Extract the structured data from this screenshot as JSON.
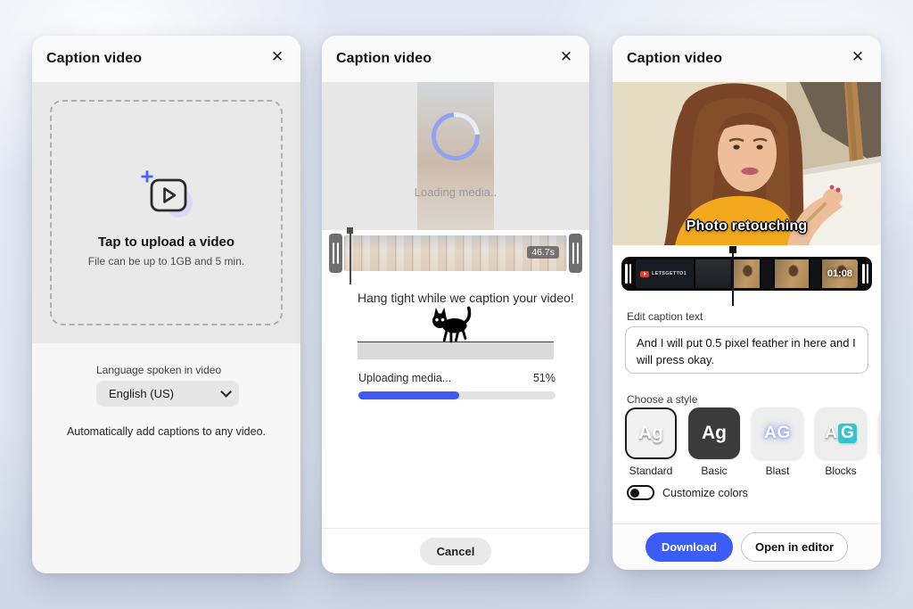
{
  "icons": {
    "close": "✕"
  },
  "colors": {
    "accent": "#3b5cf6",
    "progress": "#3d5af5",
    "teal": "#35c3ce"
  },
  "panel_upload": {
    "title": "Caption video",
    "headline": "Tap to upload a video",
    "subtext": "File can be up to 1GB and 5 min.",
    "language_label": "Language spoken in video",
    "language_value": "English (US)",
    "footnote": "Automatically add captions to any video."
  },
  "panel_progress": {
    "title": "Caption video",
    "loading_text": "Loading media..",
    "duration_badge": "46.7s",
    "headline": "Hang tight while we caption your video!",
    "status_label": "Uploading media...",
    "percent_label": "51%",
    "percent_value": 51,
    "cancel_label": "Cancel"
  },
  "panel_edit": {
    "title": "Caption video",
    "video_caption": "Photo retouching",
    "watermark": "LETSGETTO1",
    "duration_badge": "01:08",
    "edit_label": "Edit caption text",
    "caption_text": "And I will put 0.5 pixel feather in here and I will press okay.",
    "style_label": "Choose a style",
    "styles": [
      {
        "glyph": "Ag",
        "label": "Standard"
      },
      {
        "glyph": "Ag",
        "label": "Basic"
      },
      {
        "glyph": "AG",
        "label": "Blast"
      },
      {
        "glyph_a": "A",
        "glyph_g": "G",
        "label": "Blocks"
      }
    ],
    "toggle_label": "Customize colors",
    "download_label": "Download",
    "open_editor_label": "Open in editor"
  }
}
